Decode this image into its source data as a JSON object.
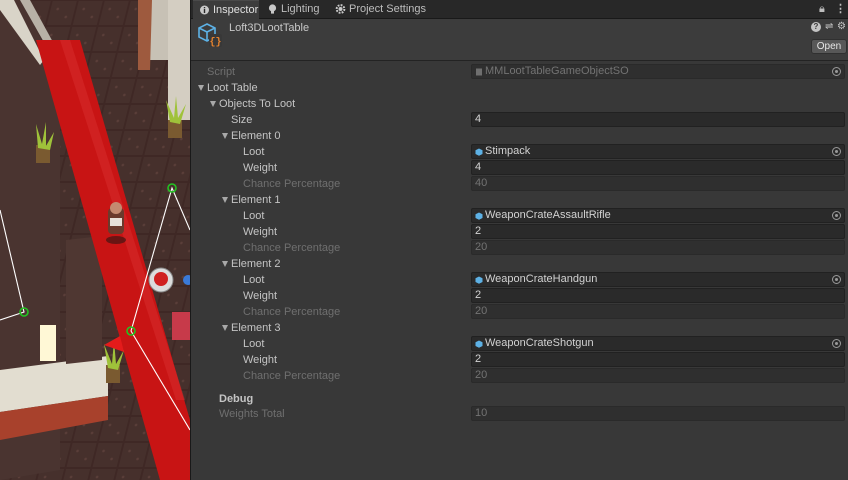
{
  "tabs": [
    {
      "label": "Inspector",
      "icon": "info-icon"
    },
    {
      "label": "Lighting",
      "icon": "lightbulb-icon"
    },
    {
      "label": "Project Settings",
      "icon": "gear-icon"
    }
  ],
  "header": {
    "object_name": "Loft3DLootTable",
    "open_label": "Open",
    "object_icon": "scriptable-object-icon"
  },
  "inspector": {
    "script_label": "Script",
    "script_value": "MMLootTableGameObjectSO",
    "loot_table_label": "Loot Table",
    "objects_to_loot_label": "Objects To Loot",
    "size_label": "Size",
    "size_value": "4",
    "elements": [
      {
        "title": "Element 0",
        "loot_label": "Loot",
        "loot_value": "Stimpack",
        "weight_label": "Weight",
        "weight_value": "4",
        "chance_label": "Chance Percentage",
        "chance_value": "40"
      },
      {
        "title": "Element 1",
        "loot_label": "Loot",
        "loot_value": "WeaponCrateAssaultRifle",
        "weight_label": "Weight",
        "weight_value": "2",
        "chance_label": "Chance Percentage",
        "chance_value": "20"
      },
      {
        "title": "Element 2",
        "loot_label": "Loot",
        "loot_value": "WeaponCrateHandgun",
        "weight_label": "Weight",
        "weight_value": "2",
        "chance_label": "Chance Percentage",
        "chance_value": "20"
      },
      {
        "title": "Element 3",
        "loot_label": "Loot",
        "loot_value": "WeaponCrateShotgun",
        "weight_label": "Weight",
        "weight_value": "2",
        "chance_label": "Chance Percentage",
        "chance_value": "20"
      }
    ],
    "debug_label": "Debug",
    "weights_total_label": "Weights Total",
    "weights_total_value": "10"
  },
  "colors": {
    "inspector_bg": "#383838",
    "field_bg": "#2a2a2a",
    "scene_red_carpet": "#c81414",
    "scene_floor": "#3e2724",
    "gizmo_green": "#22c422",
    "prefab_icon_blue": "#5db1e5"
  }
}
